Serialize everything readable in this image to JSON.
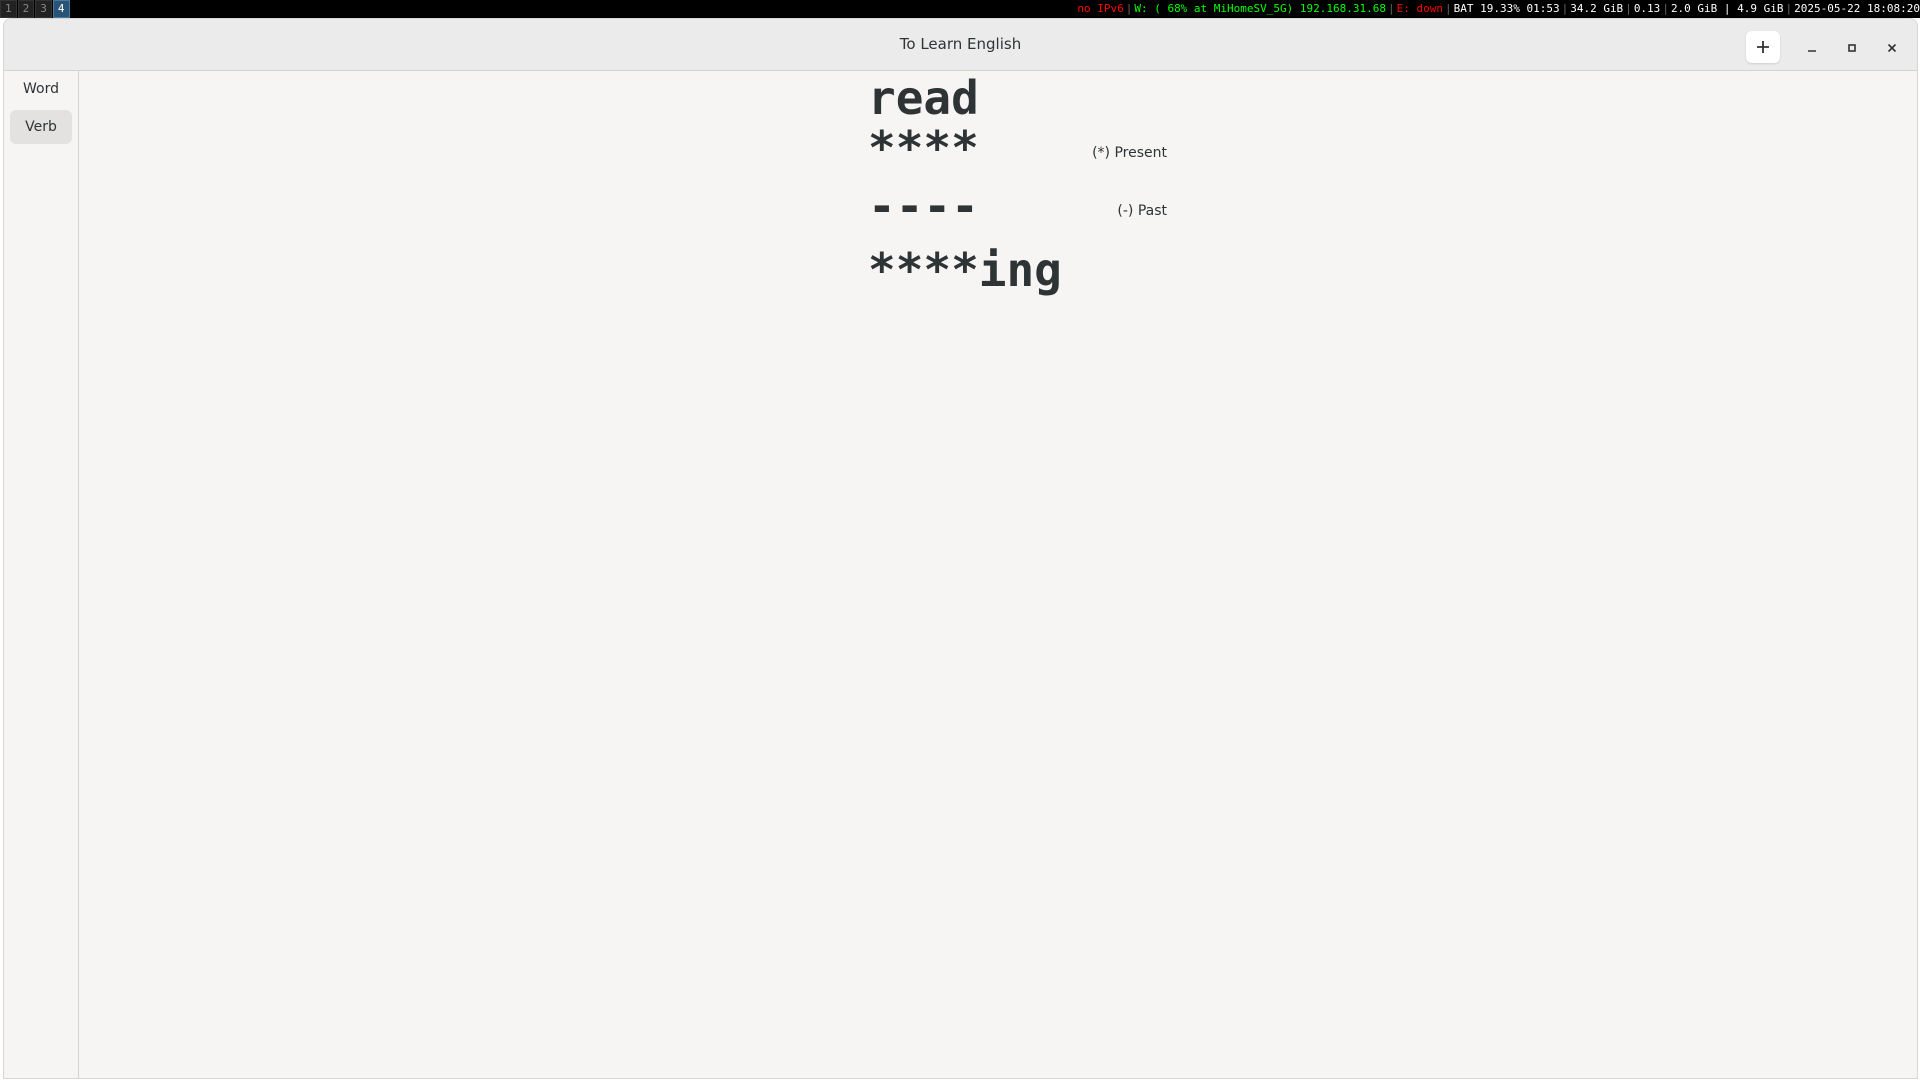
{
  "statusbar": {
    "workspaces": [
      "1",
      "2",
      "3",
      "4"
    ],
    "focused_workspace": "4",
    "items": [
      {
        "text": "no IPv6",
        "color": "#ff0000"
      },
      {
        "text": "W: ( 68% at MiHomeSV_5G) 192.168.31.68",
        "color": "#00ff00"
      },
      {
        "text": "E: down",
        "color": "#ff0000"
      },
      {
        "text": "BAT 19.33% 01:53",
        "color": "#ffffff"
      },
      {
        "text": "34.2 GiB",
        "color": "#ffffff"
      },
      {
        "text": "0.13",
        "color": "#ffffff"
      },
      {
        "text": "2.0 GiB | 4.9 GiB",
        "color": "#ffffff"
      },
      {
        "text": "2025-05-22 18:08:20",
        "color": "#ffffff"
      }
    ]
  },
  "window": {
    "title": "To Learn English",
    "buttons": {
      "add": "add-icon",
      "minimize": "minimize-icon",
      "maximize": "maximize-icon",
      "close": "close-icon"
    }
  },
  "sidebar": {
    "items": [
      {
        "label": "Word",
        "selected": false
      },
      {
        "label": "Verb",
        "selected": true
      }
    ]
  },
  "verb": {
    "base": "read",
    "present": "****",
    "present_hint": "(*) Present",
    "past": "----",
    "past_hint": "(-) Past",
    "ing": "****ing"
  }
}
